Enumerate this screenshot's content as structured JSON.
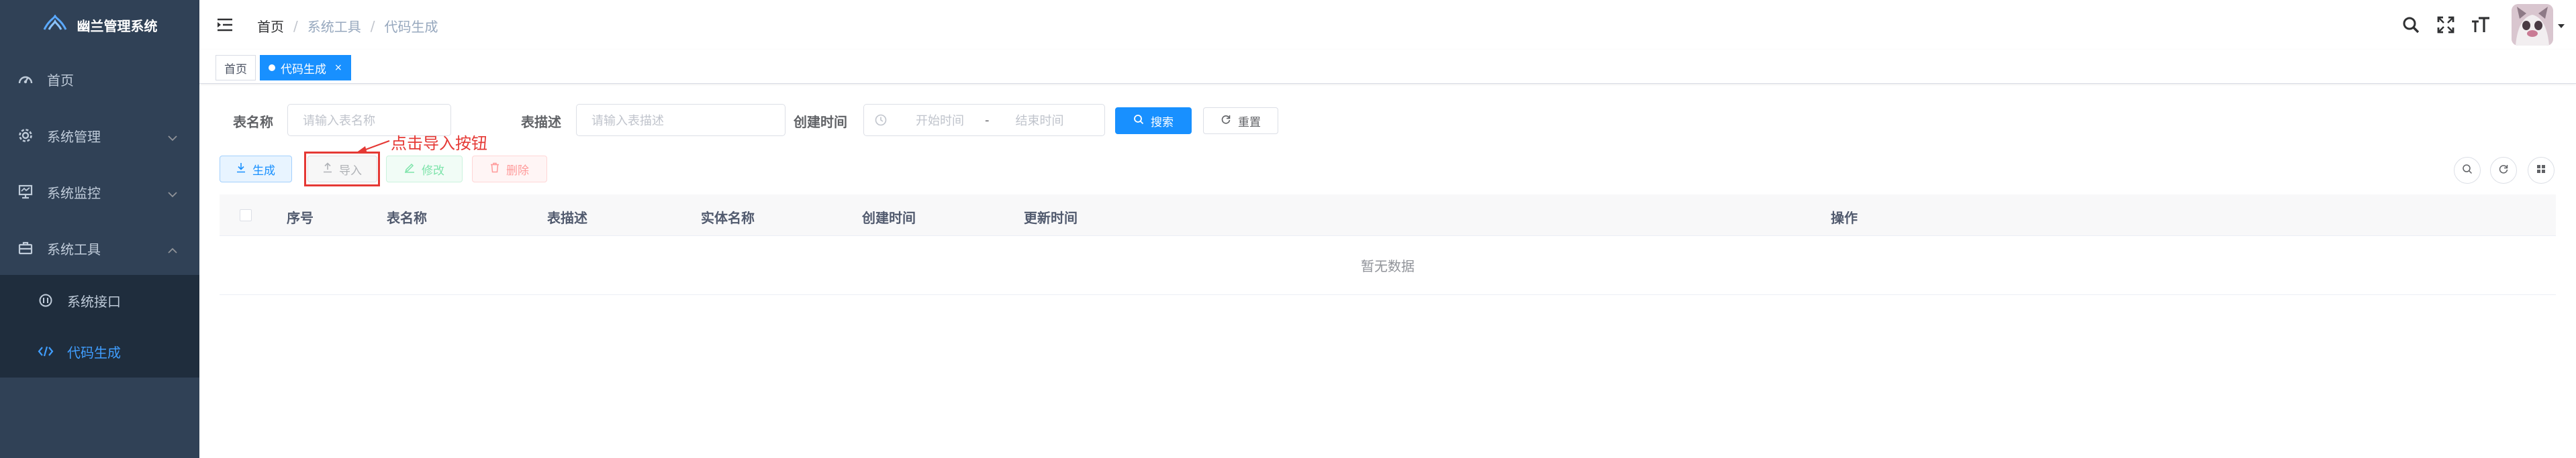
{
  "app": {
    "title": "幽兰管理系统"
  },
  "sidebar": {
    "items": [
      {
        "label": "首页",
        "icon": "dashboard-icon"
      },
      {
        "label": "系统管理",
        "icon": "system-icon"
      },
      {
        "label": "系统监控",
        "icon": "monitor-icon"
      },
      {
        "label": "系统工具",
        "icon": "tool-icon"
      }
    ],
    "subitems": [
      {
        "label": "系统接口",
        "icon": "api-icon"
      },
      {
        "label": "代码生成",
        "icon": "code-icon",
        "active": true
      }
    ]
  },
  "breadcrumb": {
    "items": [
      "首页",
      "系统工具",
      "代码生成"
    ],
    "separator": "/"
  },
  "tags": {
    "items": [
      {
        "label": "首页"
      },
      {
        "label": "代码生成",
        "active": true,
        "close": "×"
      }
    ]
  },
  "search": {
    "table_name_label": "表名称",
    "table_name_placeholder": "请输入表名称",
    "table_desc_label": "表描述",
    "table_desc_placeholder": "请输入表描述",
    "created_label": "创建时间",
    "start_placeholder": "开始时间",
    "range_separator": "-",
    "end_placeholder": "结束时间",
    "search_button": "搜索",
    "reset_button": "重置"
  },
  "toolbar": {
    "generate": "生成",
    "import": "导入",
    "edit": "修改",
    "delete": "删除"
  },
  "annotation": {
    "text": "点击导入按钮"
  },
  "table": {
    "columns": [
      "序号",
      "表名称",
      "表描述",
      "实体名称",
      "创建时间",
      "更新时间",
      "操作"
    ],
    "empty_text": "暂无数据"
  },
  "colors": {
    "sidebar_bg": "#304156",
    "submenu_bg": "#1f2d3d",
    "primary": "#1890ff",
    "active_menu": "#409eff",
    "annotation": "#e53935"
  }
}
